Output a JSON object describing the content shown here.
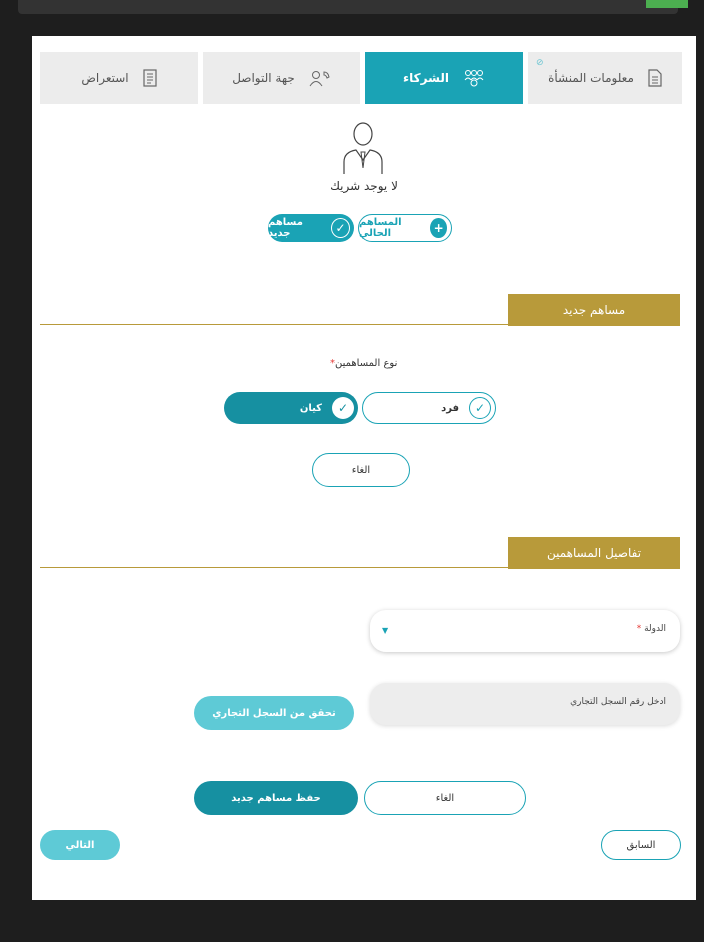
{
  "tabs": [
    {
      "label": "معلومات المنشأة",
      "icon": "document-icon",
      "completed": true
    },
    {
      "label": "الشركاء",
      "icon": "group-icon",
      "active": true
    },
    {
      "label": "جهة التواصل",
      "icon": "contact-phone-icon"
    },
    {
      "label": "استعراض",
      "icon": "review-document-icon"
    }
  ],
  "partners": {
    "empty_text": "لا يوجد شريك",
    "existing_label": "المساهم الحالي",
    "new_label": "مساهم جديد"
  },
  "new_shareholder": {
    "title": "مساهم جديد",
    "type_label": "نوع المساهمين",
    "required_mark": "*",
    "options": [
      "فرد",
      "كيان"
    ],
    "selected": "كيان",
    "cancel": "الغاء"
  },
  "shareholder_details": {
    "title": "تفاصيل المساهمين",
    "country_label": "الدولة",
    "required_mark": "*",
    "cr_placeholder": "ادخل رقم السجل التجاري",
    "verify_button": "تحقق من السجل التجاري",
    "cancel": "الغاء",
    "save": "حفظ مساهم جديد"
  },
  "nav": {
    "previous": "السابق",
    "next": "التالي"
  },
  "colors": {
    "teal": "#1aa3b5",
    "gold": "#b89a3a",
    "tab_gray": "#ececec"
  }
}
